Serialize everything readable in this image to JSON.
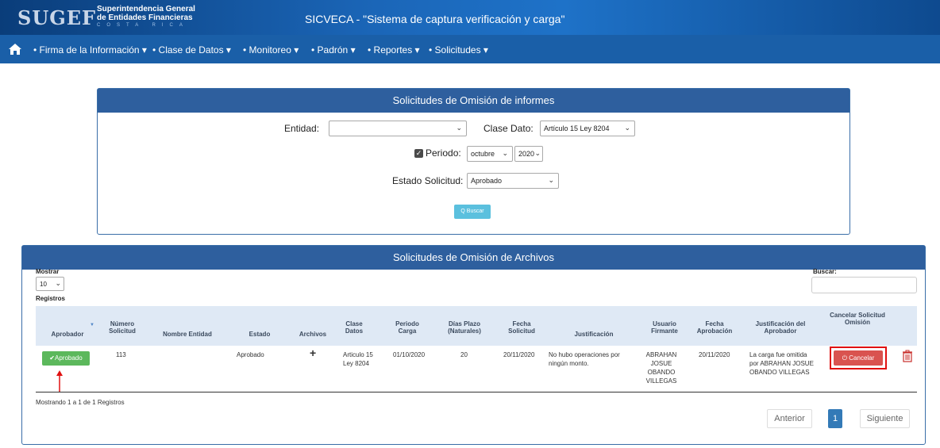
{
  "header": {
    "logo_mark": "SUGEF",
    "logo_line1": "Superintendencia General",
    "logo_line2": "de Entidades Financieras",
    "logo_line3": "COSTA RICA",
    "title": "SICVECA - \"Sistema de captura verificación y carga\""
  },
  "nav": {
    "home_icon": "home-icon",
    "items": [
      {
        "label": "• Firma de la Información ▾"
      },
      {
        "label": "• Clase de Datos ▾"
      },
      {
        "label": "• Monitoreo ▾"
      },
      {
        "label": "• Padrón ▾"
      },
      {
        "label": "• Reportes ▾"
      },
      {
        "label": "• Solicitudes ▾"
      }
    ]
  },
  "filters": {
    "title": "Solicitudes de Omisión de informes",
    "entidad_label": "Entidad:",
    "entidad_value": "",
    "clase_label": "Clase Dato:",
    "clase_value": "Artículo 15 Ley 8204",
    "periodo_label": "Periodo:",
    "periodo_checked": true,
    "mes_value": "octubre",
    "anio_value": "2020",
    "estado_label": "Estado Solicitud:",
    "estado_value": "Aprobado",
    "buscar_label": "Q Buscar"
  },
  "archivos": {
    "title": "Solicitudes de Omisión de Archivos",
    "mostrar_label": "Mostrar",
    "page_size": "10",
    "registros_label": "Registros",
    "buscar_label": "Buscar:",
    "buscar_value": "",
    "columns": [
      "Aprobador",
      "Número Solicitud",
      "Nombre Entidad",
      "Estado",
      "Archivos",
      "Clase Datos",
      "Periodo Carga",
      "Días Plazo (Naturales)",
      "Fecha Solicitud",
      "Justificación",
      "Usuario Firmante",
      "Fecha Aprobación",
      "Justificación del Aprobador",
      "Cancelar Solicitud Omisión"
    ],
    "rows": [
      {
        "aprobador": "✔Aprobado",
        "numero": "113",
        "entidad": "",
        "estado": "Aprobado",
        "archivos": "+",
        "clase": "Articulo 15 Ley 8204",
        "periodo": "01/10/2020",
        "dias": "20",
        "fecha_solicitud": "20/11/2020",
        "justificacion": "No hubo operaciones por ningún monto.",
        "usuario": "ABRAHAN JOSUE OBANDO VILLEGAS",
        "fecha_aprobacion": "20/11/2020",
        "just_aprobador": "La carga fue omitida por ABRAHAN JOSUE OBANDO VILLEGAS",
        "cancelar": "Cancelar"
      }
    ],
    "info": "Mostrando 1 a 1 de 1 Registros",
    "pagination": {
      "prev": "Anterior",
      "current": "1",
      "next": "Siguiente"
    }
  }
}
